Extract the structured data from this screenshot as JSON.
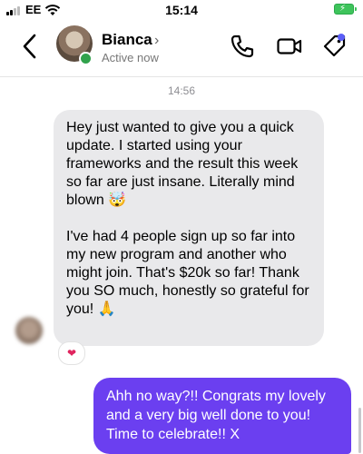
{
  "status_bar": {
    "carrier": "EE",
    "time": "15:14",
    "battery_icon": "battery-charging-icon",
    "colors": {
      "battery": "#3ec45b"
    }
  },
  "header": {
    "contact_name": "Bianca",
    "chevron": "›",
    "status": "Active now",
    "icons": [
      "back-chevron-icon",
      "phone-icon",
      "video-icon",
      "tag-icon"
    ]
  },
  "conversation": {
    "timestamp": "14:56",
    "incoming_message": {
      "paragraph_1": "Hey just wanted to give you a quick update. I started using your frameworks and the result this week so far are just insane. Literally mind blown 🤯",
      "paragraph_2": "I've had 4 people sign up so far into my new program and another who might join. That's $20k so far! Thank you SO much, honestly so grateful for you! 🙏"
    },
    "reaction": "❤",
    "outgoing_message": "Ahh no way?!! Congrats my lovely and a very big well done to you! Time to celebrate!! X"
  },
  "colors": {
    "outgoing_bubble": "#6b3ff0",
    "incoming_bubble": "#e9e9eb",
    "presence": "#31a24c",
    "accent_dot": "#5b5ef7"
  }
}
